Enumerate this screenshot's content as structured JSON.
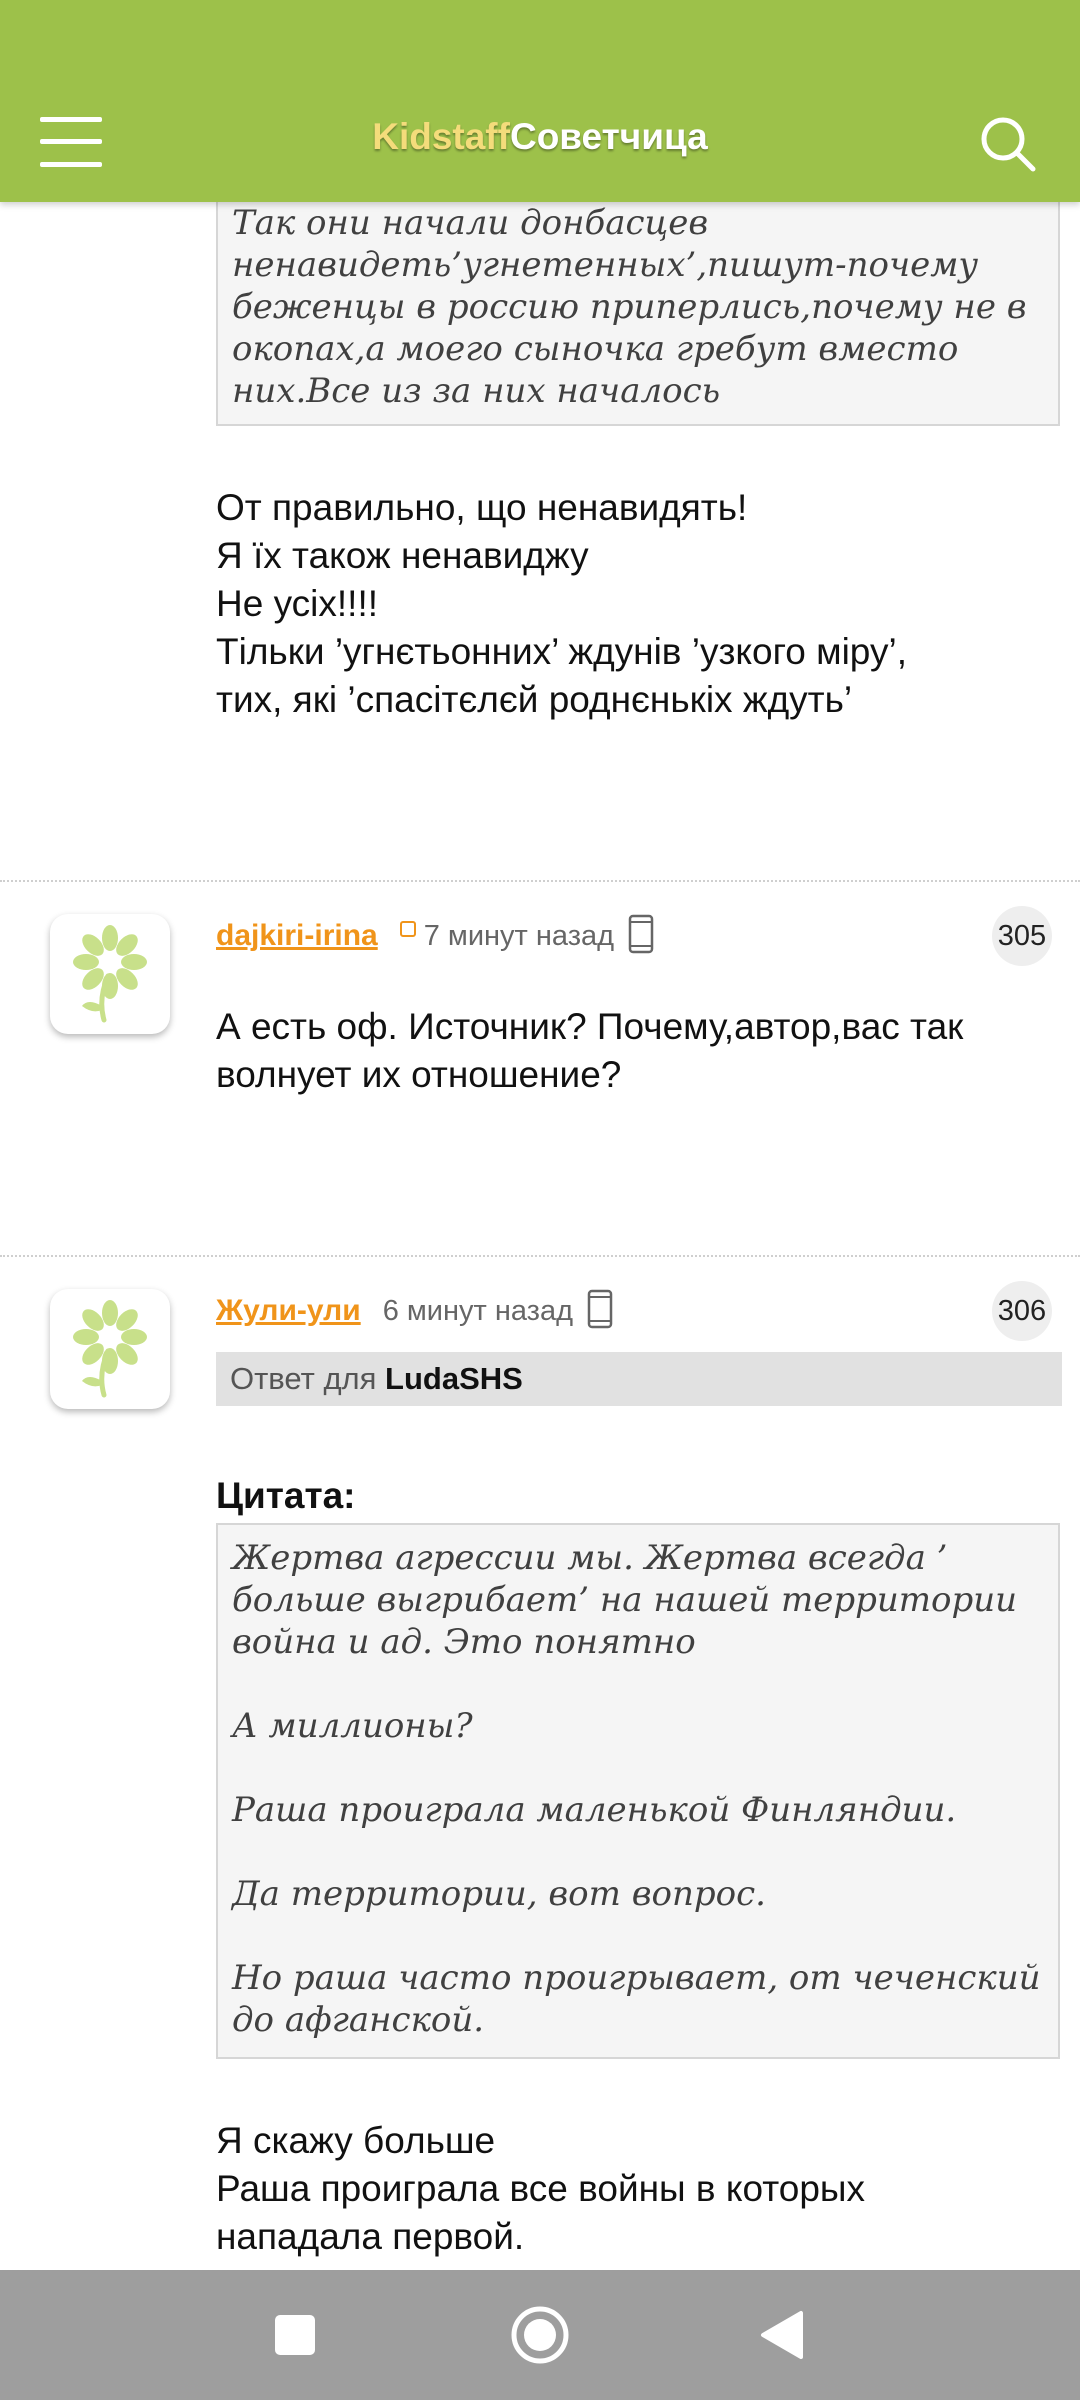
{
  "app": {
    "logo_part1": "Kidstaff",
    "logo_part2": "Советчица"
  },
  "icons": {
    "menu": "hamburger-menu-icon",
    "search": "search-icon",
    "device": "phone-icon",
    "avatar": "flower-icon"
  },
  "colors": {
    "header": "#9dc14a",
    "username": "#f0941a",
    "navbar": "#9e9e9e"
  },
  "top_quote": {
    "lines": [
      "Так они начали донбасцев",
      "ненавидеть’угнетенных’,пишут-почему",
      "беженцы в россию приперлись,почему не в",
      "окопах,а моего сыночка гребут вместо",
      "них.Все из за них началось"
    ]
  },
  "top_post": {
    "lines": [
      "От правильно, що ненавидять!",
      "Я їх також ненавиджу",
      "Не усіх!!!!",
      "Тільки ’угнєтьонних’ ждунів ’узкого міру’,",
      "тих, які ’спасітєлєй роднєнькіх ждуть’"
    ]
  },
  "comments": [
    {
      "username": "dajkiri-irina",
      "time": "7 минут назад",
      "number": "305",
      "text_lines": [
        "А есть оф. Источник? Почему,автор,вас так",
        "волнует их отношение?"
      ]
    },
    {
      "username": "Жули-ули",
      "time": "6 минут назад",
      "number": "306",
      "reply_prefix": "Ответ для",
      "reply_to": "LudaSHS",
      "quote_heading": "Цитата:",
      "quote_paragraphs": [
        [
          "Жертва агрессии мы. Жертва всегда ’",
          "больше выгрибает’ на нашей территории",
          "война и ад. Это понятно"
        ],
        [
          "А миллионы?"
        ],
        [
          "Раша проиграла маленькой Финляндии."
        ],
        [
          "Да территории, вот вопрос."
        ],
        [
          "Но раша часто проигрывает, от чеченский",
          "до афганской."
        ]
      ],
      "text_lines": [
        "Я скажу больше",
        "Раша проиграла все войны в которых",
        "нападала первой."
      ]
    }
  ],
  "navbar": {
    "buttons": [
      "recents-button",
      "home-button",
      "back-button"
    ]
  }
}
